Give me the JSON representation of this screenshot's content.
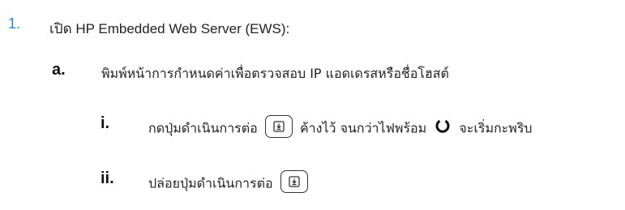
{
  "steps": {
    "step1": {
      "number": "1.",
      "text": "เปิด HP Embedded Web Server (EWS):"
    },
    "stepa": {
      "number": "a.",
      "text": "พิมพ์หน้าการกำหนดค่าเพื่อตรวจสอบ IP แอดเดรสหรือชื่อโฮสต์"
    },
    "stepi": {
      "number": "i.",
      "text_before": "กดปุ่มดำเนินการต่อ",
      "text_middle": "ค้างไว้ จนกว่าไฟพร้อม",
      "text_after": "จะเริ่มกะพริบ",
      "icons": [
        "resume-button-icon",
        "ready-light-icon"
      ]
    },
    "stepii": {
      "number": "ii.",
      "text": "ปล่อยปุ่มดำเนินการต่อ",
      "icons": [
        "resume-button-icon"
      ]
    }
  },
  "colors": {
    "step_number_primary": "#1a8ad9",
    "text": "#222222"
  }
}
